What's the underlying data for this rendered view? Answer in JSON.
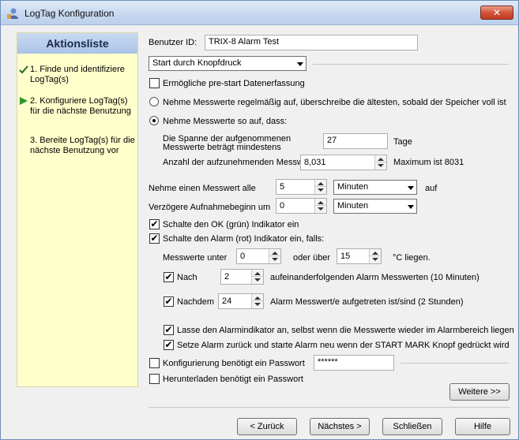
{
  "window": {
    "title": "LogTag Konfiguration",
    "close_glyph": "✕"
  },
  "sidebar": {
    "title": "Aktionsliste",
    "steps": [
      {
        "label": "1. Finde und identifiziere LogTag(s)",
        "mark": "checkmark-icon"
      },
      {
        "label": "2. Konfiguriere LogTag(s) für die nächste Benutzung",
        "mark": "arrow-icon"
      },
      {
        "label": "3. Bereite LogTag(s) für die nächste Benutzung vor",
        "mark": ""
      }
    ]
  },
  "form": {
    "user_id_label": "Benutzer ID:",
    "user_id_value": "TRIX-8 Alarm Test",
    "start_mode": "Start durch Knopfdruck",
    "prestart_label": "Ermögliche pre-start Datenerfassung",
    "radio_overwrite_label": "Nehme Messwerte regelmäßig auf, überschreibe die ältesten, sobald der Speicher voll ist",
    "radio_until_label": "Nehme Messwerte so auf, dass:",
    "span_label_1": "Die Spanne der aufgenommenen",
    "span_label_2": "Messwerte beträgt mindestens",
    "span_value": "27",
    "span_unit": "Tage",
    "count_label": "Anzahl der aufzunehmenden Messwerte",
    "count_value": "8,031",
    "count_max": "Maximum ist 8031",
    "interval_label": "Nehme einen Messwert alle",
    "interval_value": "5",
    "interval_unit": "Minuten",
    "interval_suffix": "auf",
    "delay_label": "Verzögere Aufnahmebeginn um",
    "delay_value": "0",
    "delay_unit": "Minuten",
    "ok_indicator_label": "Schalte den OK (grün) Indikator ein",
    "alarm_indicator_label": "Schalte den Alarm (rot) Indikator ein, falls:",
    "below_label": "Messwerte unter",
    "below_value": "0",
    "above_label": "oder über",
    "above_value": "15",
    "temp_suffix": "°C liegen.",
    "after_label": "Nach",
    "after_value": "2",
    "after_suffix": "aufeinanderfolgenden Alarm Messwerten (10 Minuten)",
    "afterall_label": "Nachdem",
    "afterall_value": "24",
    "afterall_suffix": "Alarm Messwert/e aufgetreten ist/sind (2 Stunden)",
    "latch_label": "Lasse den Alarmindikator an, selbst wenn die Messwerte wieder im Alarmbereich liegen",
    "reset_label": "Setze Alarm zurück und starte Alarm neu wenn der START MARK Knopf gedrückt wird",
    "config_pw_label": "Konfigurierung benötigt ein Passwort",
    "config_pw_value": "******",
    "download_pw_label": "Herunterladen benötigt ein Passwort",
    "more_button": "Weitere >>"
  },
  "footer": {
    "back": "< Zurück",
    "next": "Nächstes >",
    "close": "Schließen",
    "help": "Hilfe"
  },
  "check_glyph": "✔"
}
